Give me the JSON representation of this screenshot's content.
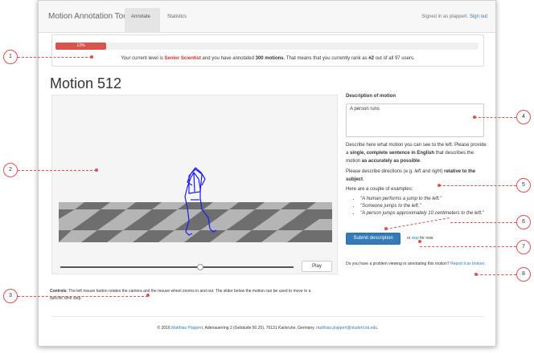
{
  "navbar": {
    "brand": "Motion Annotation Tool",
    "tabs": [
      {
        "label": "Annotate",
        "active": true
      },
      {
        "label": "Statistics",
        "active": false
      }
    ],
    "signed_in_prefix": "Signed in as plappert.",
    "sign_out": "Sign out"
  },
  "status": {
    "progress_label": "12%",
    "progress_value": 0.12,
    "text_before_level": "Your current level is",
    "level": "Senior Scientist",
    "text_before_count": "and you have annotated",
    "count": "300 motions",
    "text_before_rank": ". That means that you currently rank as",
    "rank": "#2",
    "text_after_rank": "out of all 97 users."
  },
  "motion": {
    "title": "Motion 512",
    "play_label": "Play",
    "slider_position": 0.6,
    "controls_bold": "Controls",
    "controls_text": ": The left mouse button rotates the camera and the mouse wheel zooms in and out. The slider below the motion can be used to move to a specific time step."
  },
  "description": {
    "label": "Description of motion",
    "value": "A person runs",
    "help1_a": "Describe here what motion you can see to the left. Please provide a",
    "help1_bold": "single, complete sentence in English",
    "help1_b": "that describes the motion",
    "help1_bold2": "as accurately as possible",
    "help1_c": ".",
    "help2_a": "Please describe directions (e.g.",
    "help2_italic1": "left",
    "help2_and": "and",
    "help2_italic2": "right",
    "help2_b": ")",
    "help2_bold": "relative to the subject",
    "help2_c": ".",
    "help3": "Here are a couple of examples:",
    "examples": [
      "\"A human performs a jump to the left.\"",
      "\"Someone jumps to the left.\"",
      "\"A person jumps approximately 10 centimeters to the left.\""
    ],
    "submit_label": "Submit description",
    "or_text": "or",
    "skip_link": "skip",
    "for_now": "for now",
    "problem_text": "Do you have a problem viewing or annotating this motion?",
    "report_link": "Report it as broken."
  },
  "footer": {
    "prefix": "© 2016",
    "author": "Matthias Plappert",
    "address": ", Adenauerring 2 (Gebäude 50.20), 76131 Karlsruhe, Germany.",
    "email": "matthias.plappert@student.kit.edu",
    "suffix": "."
  },
  "callouts": [
    "1",
    "2",
    "3",
    "4",
    "5",
    "6",
    "7",
    "8"
  ],
  "colors": {
    "accent_red": "#d9534f",
    "primary_blue": "#337ab7",
    "level_red": "#c9302c",
    "skeleton_blue": "#1a1aff"
  }
}
